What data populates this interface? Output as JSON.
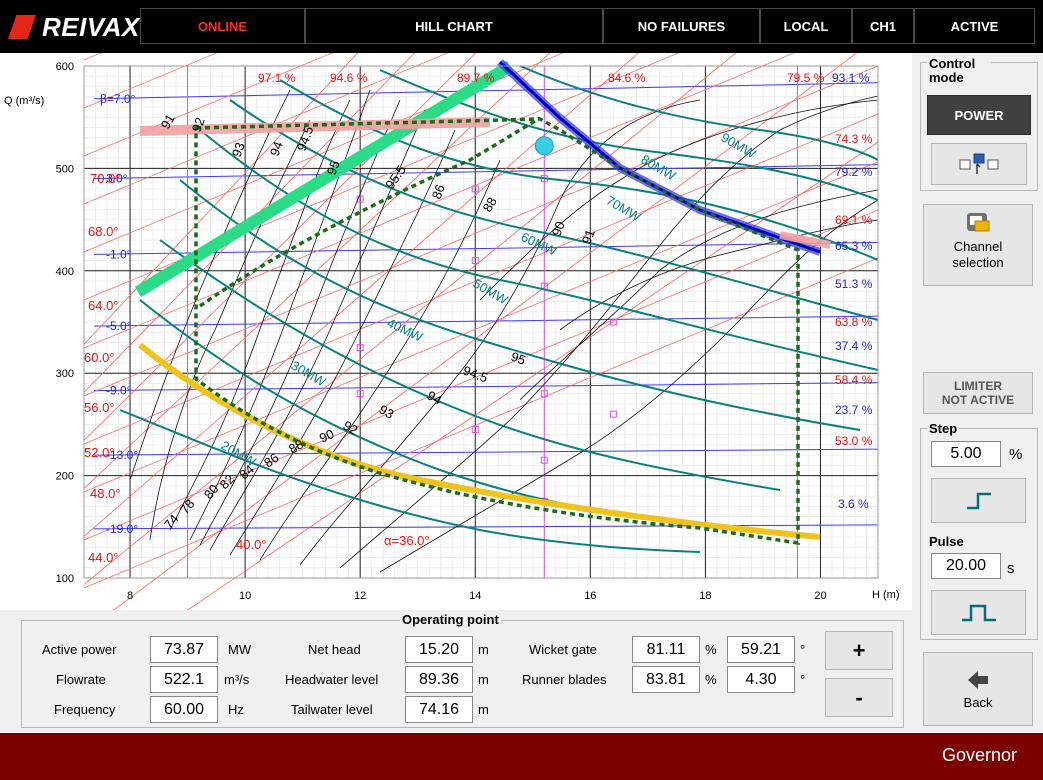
{
  "header": {
    "brand": "REIVAX",
    "status_online": "ONLINE",
    "view_title": "HILL CHART",
    "failures": "NO FAILURES",
    "location": "LOCAL",
    "channel": "CH1",
    "state": "ACTIVE"
  },
  "colors": {
    "top_bar": "#000000",
    "online": "#ff2a2a",
    "footer": "#7d0000",
    "teal_power": "#00807f",
    "efficiency": "#000000",
    "beta": "#0000e0",
    "alpha": "#ff0000"
  },
  "chart_data": {
    "type": "scatter",
    "xlabel": "H (m)",
    "ylabel": "Q (m³/s)",
    "xlim": [
      7.2,
      21
    ],
    "ylim": [
      100,
      600
    ],
    "x_ticks": [
      "8",
      "10",
      "12",
      "14",
      "16",
      "18",
      "20"
    ],
    "y_ticks": [
      "100",
      "200",
      "300",
      "400",
      "500",
      "600"
    ],
    "grid": true,
    "beta_lines": [
      {
        "label": "β=7.0°",
        "q": 568
      },
      {
        "label": "3.0°",
        "q": 490
      },
      {
        "label": "-1.0°",
        "q": 416
      },
      {
        "label": "-5.0°",
        "q": 346
      },
      {
        "label": "-9.0°",
        "q": 283
      },
      {
        "label": "-13.0°",
        "q": 220
      },
      {
        "label": "-19.0°",
        "q": 148
      }
    ],
    "alpha_labels": [
      "70.0°",
      "68.0°",
      "64.0°",
      "60.0°",
      "56.0°",
      "52.0°",
      "48.0°",
      "44.0°",
      "40.0°",
      "α=36.0°"
    ],
    "gate_pct_top": [
      "97.1 %",
      "94.6 %",
      "89.7 %",
      "84.6 %",
      "79.5 %"
    ],
    "gate_pct_right": [
      "74.3 %",
      "69.1 %",
      "63.8 %",
      "58.4 %",
      "53.0 %"
    ],
    "blade_pct_right": [
      "93.1 %",
      "79.2 %",
      "65.3 %",
      "51.3 %",
      "37.4 %",
      "23.7 %",
      "3.6 %"
    ],
    "efficiency_labels": [
      "74",
      "78",
      "80",
      "82",
      "84",
      "86",
      "88",
      "90",
      "91",
      "92",
      "93",
      "94",
      "94.5",
      "95",
      "95.5",
      "86",
      "88",
      "90",
      "91",
      "92",
      "93",
      "94",
      "94.5",
      "95"
    ],
    "power_labels": [
      "20MW",
      "30MW",
      "40MW",
      "50MW",
      "60MW",
      "70MW",
      "80MW",
      "90MW"
    ],
    "operating_point": {
      "head": 15.2,
      "flow": 522.1
    }
  },
  "control_mode": {
    "title": "Control mode",
    "power_btn": "POWER",
    "channel_btn": "Channel selection"
  },
  "limiter": {
    "line1": "LIMITER",
    "line2": "NOT ACTIVE"
  },
  "step": {
    "title": "Step",
    "value": "5.00",
    "unit": "%"
  },
  "pulse": {
    "title": "Pulse",
    "value": "20.00",
    "unit": "s"
  },
  "back_btn": "Back",
  "operating_point": {
    "title": "Operating point",
    "active_power": {
      "label": "Active power",
      "value": "73.87",
      "unit": "MW"
    },
    "flowrate": {
      "label": "Flowrate",
      "value": "522.1",
      "unit": "m³/s"
    },
    "frequency": {
      "label": "Frequency",
      "value": "60.00",
      "unit": "Hz"
    },
    "net_head": {
      "label": "Net head",
      "value": "15.20",
      "unit": "m"
    },
    "headwater": {
      "label": "Headwater level",
      "value": "89.36",
      "unit": "m"
    },
    "tailwater": {
      "label": "Tailwater level",
      "value": "74.16",
      "unit": "m"
    },
    "wicket_gate": {
      "label": "Wicket gate",
      "value_pct": "81.11",
      "unit_pct": "%",
      "value_deg": "59.21",
      "unit_deg": "°"
    },
    "runner_blades": {
      "label": "Runner blades",
      "value_pct": "83.81",
      "unit_pct": "%",
      "value_deg": "4.30",
      "unit_deg": "°"
    },
    "plus": "+",
    "minus": "-"
  },
  "footer": {
    "title": "Governor"
  }
}
